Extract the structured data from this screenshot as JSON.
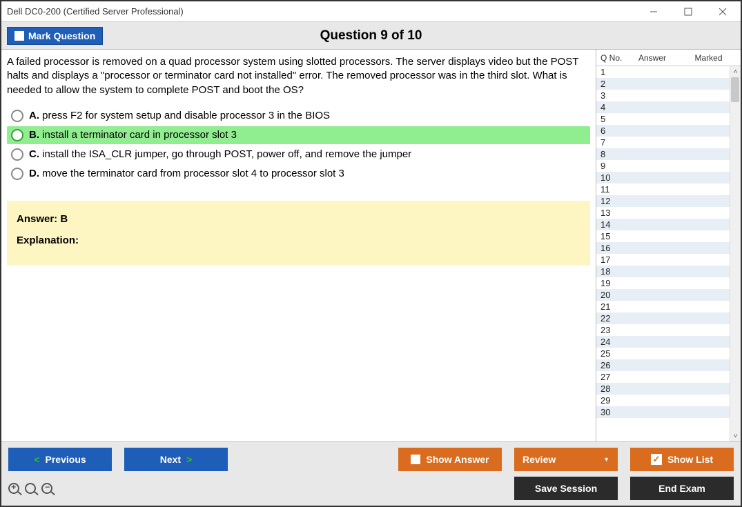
{
  "window": {
    "title": "Dell DC0-200 (Certified Server Professional)"
  },
  "header": {
    "mark_label": "Mark Question",
    "question_title": "Question 9 of 10"
  },
  "question": {
    "text": "A failed processor is removed on a quad processor system using slotted processors. The server displays video but the POST halts and displays a \"processor or terminator card not installed\" error. The removed processor was in the third slot. What is needed to allow the system to complete POST and boot the OS?",
    "options": [
      {
        "letter": "A.",
        "text": "press F2 for system setup and disable processor 3 in the BIOS",
        "correct": false
      },
      {
        "letter": "B.",
        "text": "install a terminator card in processor slot 3",
        "correct": true
      },
      {
        "letter": "C.",
        "text": "install the ISA_CLR jumper, go through POST, power off, and remove the jumper",
        "correct": false
      },
      {
        "letter": "D.",
        "text": "move the terminator card from processor slot 4 to processor slot 3",
        "correct": false
      }
    ],
    "answer_label": "Answer: B",
    "explanation_label": "Explanation:"
  },
  "sidebar": {
    "col_qno": "Q No.",
    "col_answer": "Answer",
    "col_marked": "Marked",
    "rows": [
      {
        "n": "1"
      },
      {
        "n": "2"
      },
      {
        "n": "3"
      },
      {
        "n": "4"
      },
      {
        "n": "5"
      },
      {
        "n": "6"
      },
      {
        "n": "7"
      },
      {
        "n": "8"
      },
      {
        "n": "9"
      },
      {
        "n": "10"
      },
      {
        "n": "11"
      },
      {
        "n": "12"
      },
      {
        "n": "13"
      },
      {
        "n": "14"
      },
      {
        "n": "15"
      },
      {
        "n": "16"
      },
      {
        "n": "17"
      },
      {
        "n": "18"
      },
      {
        "n": "19"
      },
      {
        "n": "20"
      },
      {
        "n": "21"
      },
      {
        "n": "22"
      },
      {
        "n": "23"
      },
      {
        "n": "24"
      },
      {
        "n": "25"
      },
      {
        "n": "26"
      },
      {
        "n": "27"
      },
      {
        "n": "28"
      },
      {
        "n": "29"
      },
      {
        "n": "30"
      }
    ]
  },
  "footer": {
    "previous": "Previous",
    "next": "Next",
    "show_answer": "Show Answer",
    "review": "Review",
    "show_list": "Show List",
    "save_session": "Save Session",
    "end_exam": "End Exam"
  }
}
